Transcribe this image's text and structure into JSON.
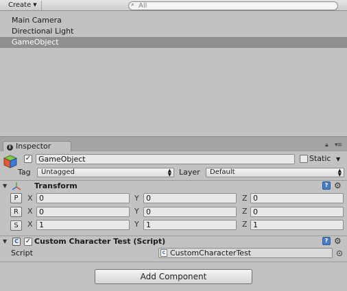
{
  "hierarchy": {
    "create_label": "Create",
    "search_placeholder": "All",
    "items": [
      {
        "label": "Main Camera"
      },
      {
        "label": "Directional Light"
      },
      {
        "label": "GameObject"
      }
    ]
  },
  "inspector_tab": {
    "label": "Inspector"
  },
  "gameobject": {
    "name": "GameObject",
    "active": true,
    "static_label": "Static",
    "static": false,
    "tag_label": "Tag",
    "tag_value": "Untagged",
    "layer_label": "Layer",
    "layer_value": "Default"
  },
  "transform": {
    "title": "Transform",
    "position": {
      "button": "P",
      "x": "0",
      "y": "0",
      "z": "0"
    },
    "rotation": {
      "button": "R",
      "x": "0",
      "y": "0",
      "z": "0"
    },
    "scale": {
      "button": "S",
      "x": "1",
      "y": "1",
      "z": "1"
    },
    "axis_x": "X",
    "axis_y": "Y",
    "axis_z": "Z"
  },
  "script_component": {
    "title": "Custom Character Test (Script)",
    "enabled": true,
    "script_label": "Script",
    "script_value": "CustomCharacterTest"
  },
  "add_component_label": "Add Component",
  "colors": {
    "selection": "#8f8f8f",
    "panel": "#c2c2c2",
    "help_blue": "#4a7cc4"
  }
}
